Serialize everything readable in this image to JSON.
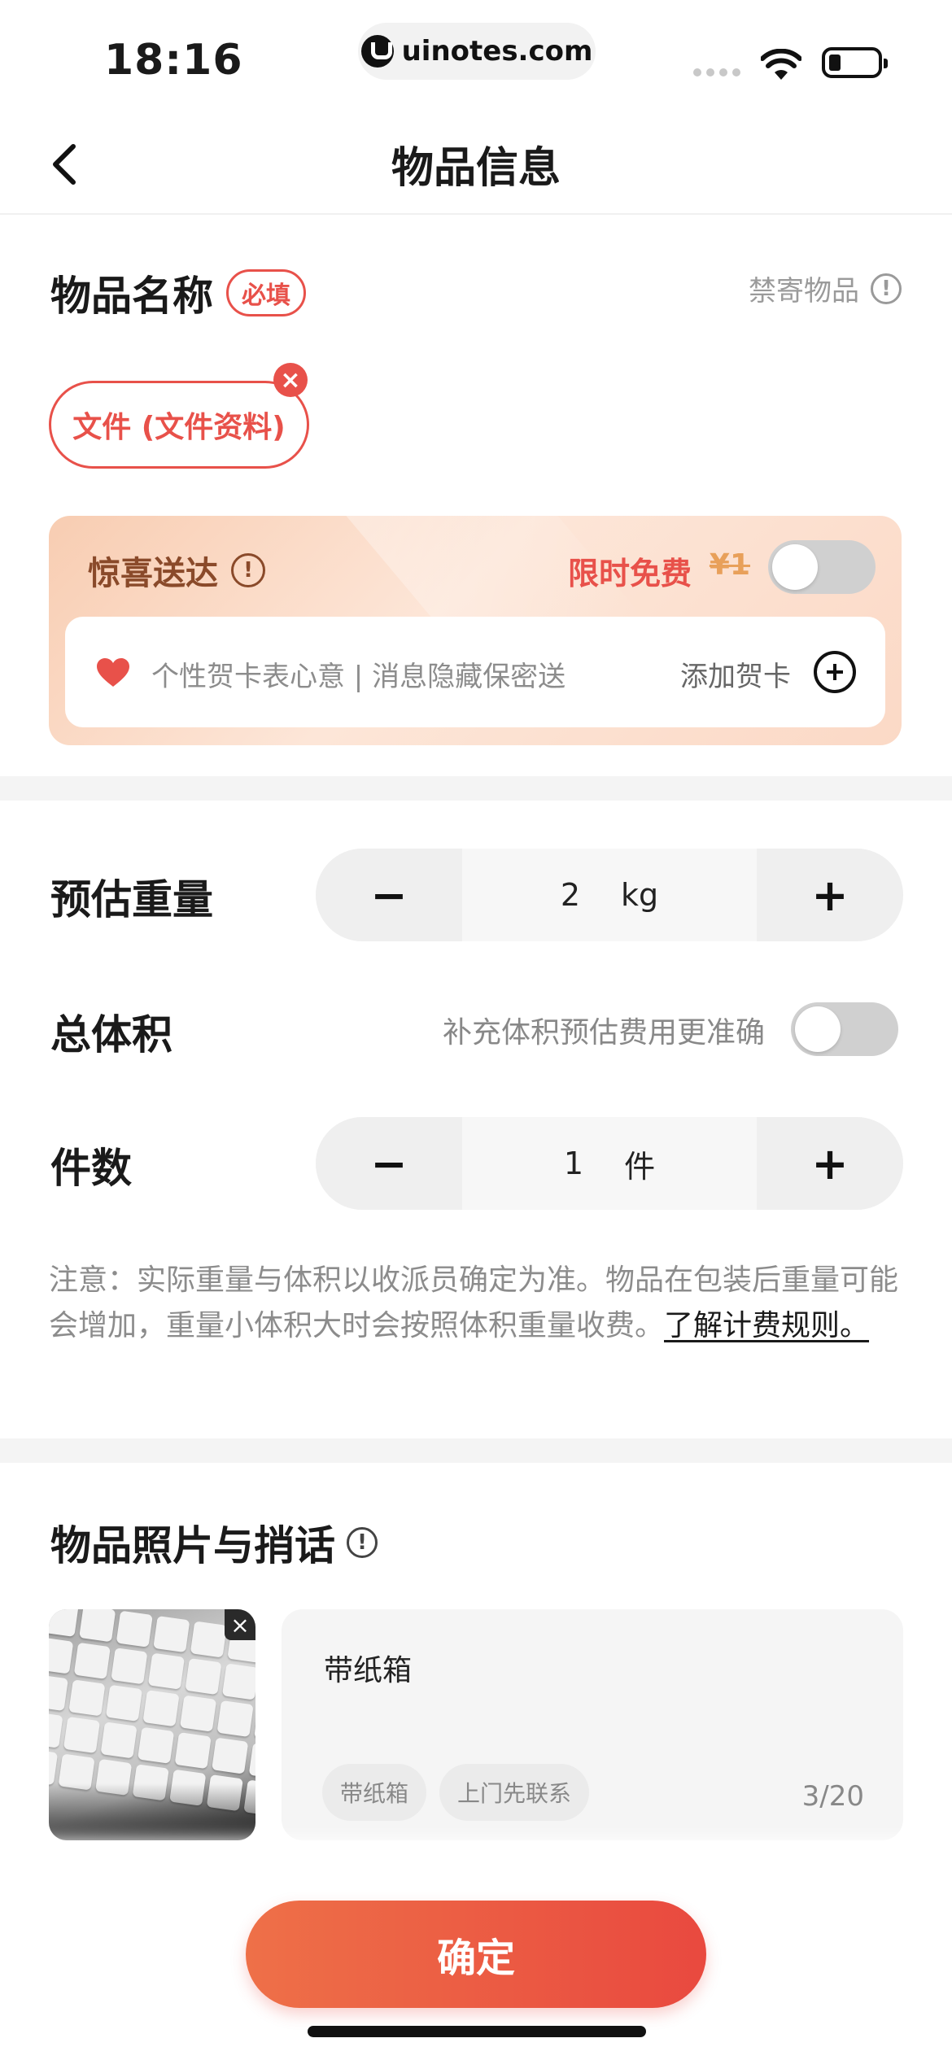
{
  "status_bar": {
    "time": "18:16",
    "url": "uinotes.com"
  },
  "nav": {
    "title": "物品信息"
  },
  "item_name": {
    "title": "物品名称",
    "required_badge": "必填",
    "forbidden_link": "禁寄物品",
    "selected_item": "文件 (文件资料)"
  },
  "surprise": {
    "title": "惊喜送达",
    "free_label": "限时免费",
    "old_price": "¥1",
    "enabled": false,
    "card_desc": "个性贺卡表心意 | 消息隐藏保密送",
    "add_card_label": "添加贺卡"
  },
  "weight": {
    "label": "预估重量",
    "value": "2",
    "unit": "kg",
    "minus": "−",
    "plus": "+"
  },
  "volume": {
    "label": "总体积",
    "hint": "补充体积预估费用更准确",
    "enabled": false
  },
  "count": {
    "label": "件数",
    "value": "1",
    "unit": "件",
    "minus": "−",
    "plus": "+"
  },
  "note": {
    "text": "注意：实际重量与体积以收派员确定为准。物品在包装后重量可能会增加，重量小体积大时会按照体积重量收费。",
    "link": "了解计费规则。"
  },
  "photos": {
    "title": "物品照片与捎话",
    "remark": "带纸箱",
    "tags": [
      "带纸箱",
      "上门先联系"
    ],
    "count": "3/20"
  },
  "confirm": {
    "label": "确定"
  },
  "colors": {
    "accent": "#e8514a",
    "surprise_text": "#8a4a2a"
  }
}
